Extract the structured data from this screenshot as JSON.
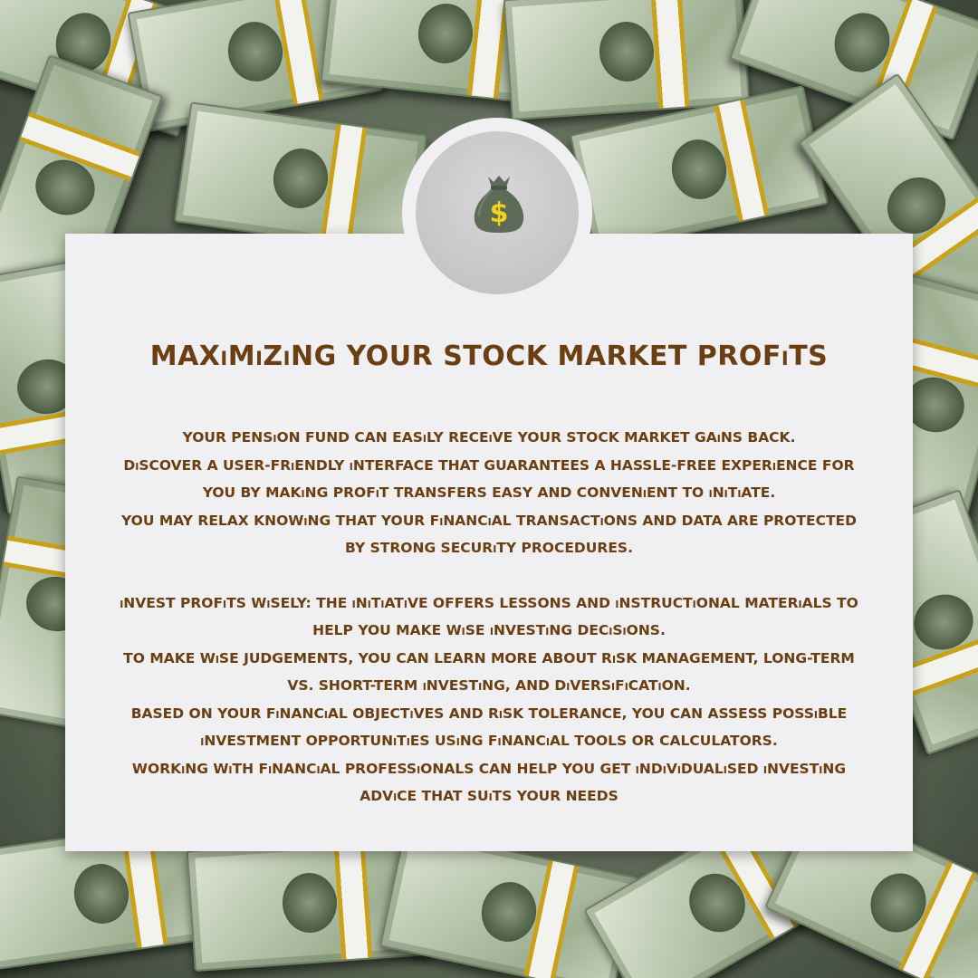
{
  "title": "MAXiMiZiNG YOUR STOCK MARKET PROFiTS",
  "icon": {
    "name": "money-bag-icon",
    "bag_color": "#5d6b58",
    "symbol": "$",
    "symbol_color": "#f2d21b"
  },
  "colors": {
    "text": "#6b3f12",
    "card": "#f0eff1"
  },
  "paragraphs": [
    [
      "YOUR PENSiON FUND CAN EASiLY RECEiVE YOUR STOCK MARKET GAiNS BACK.",
      "DiSCOVER A USER-FRiENDLY iNTERFACE THAT GUARANTEES A HASSLE-FREE EXPERiENCE FOR YOU BY MAKiNG PROFiT TRANSFERS EASY AND CONVENiENT TO iNiTiATE.",
      "YOU MAY RELAX KNOWiNG THAT YOUR FiNANCiAL TRANSACTiONS AND DATA ARE PROTECTED BY STRONG SECURiTY PROCEDURES."
    ],
    [
      "iNVEST PROFiTS WiSELY: THE iNiTiATiVE OFFERS LESSONS AND iNSTRUCTiONAL MATERiALS TO HELP YOU MAKE WiSE iNVESTiNG DECiSiONS.",
      "TO MAKE WiSE JUDGEMENTS, YOU CAN LEARN MORE ABOUT RiSK MANAGEMENT, LONG-TERM VS. SHORT-TERM iNVESTiNG, AND DiVERSiFiCATiON.",
      "BASED ON YOUR FiNANCiAL OBJECTiVES AND RiSK TOLERANCE, YOU CAN ASSESS POSSiBLE iNVESTMENT OPPORTUNiTiES USiNG FiNANCiAL TOOLS OR CALCULATORS.",
      "WORKiNG WiTH FiNANCiAL PROFESSiONALS CAN HELP YOU GET iNDiViDUALiSED iNVESTiNG ADViCE THAT SUiTS YOUR NEEDS"
    ]
  ]
}
